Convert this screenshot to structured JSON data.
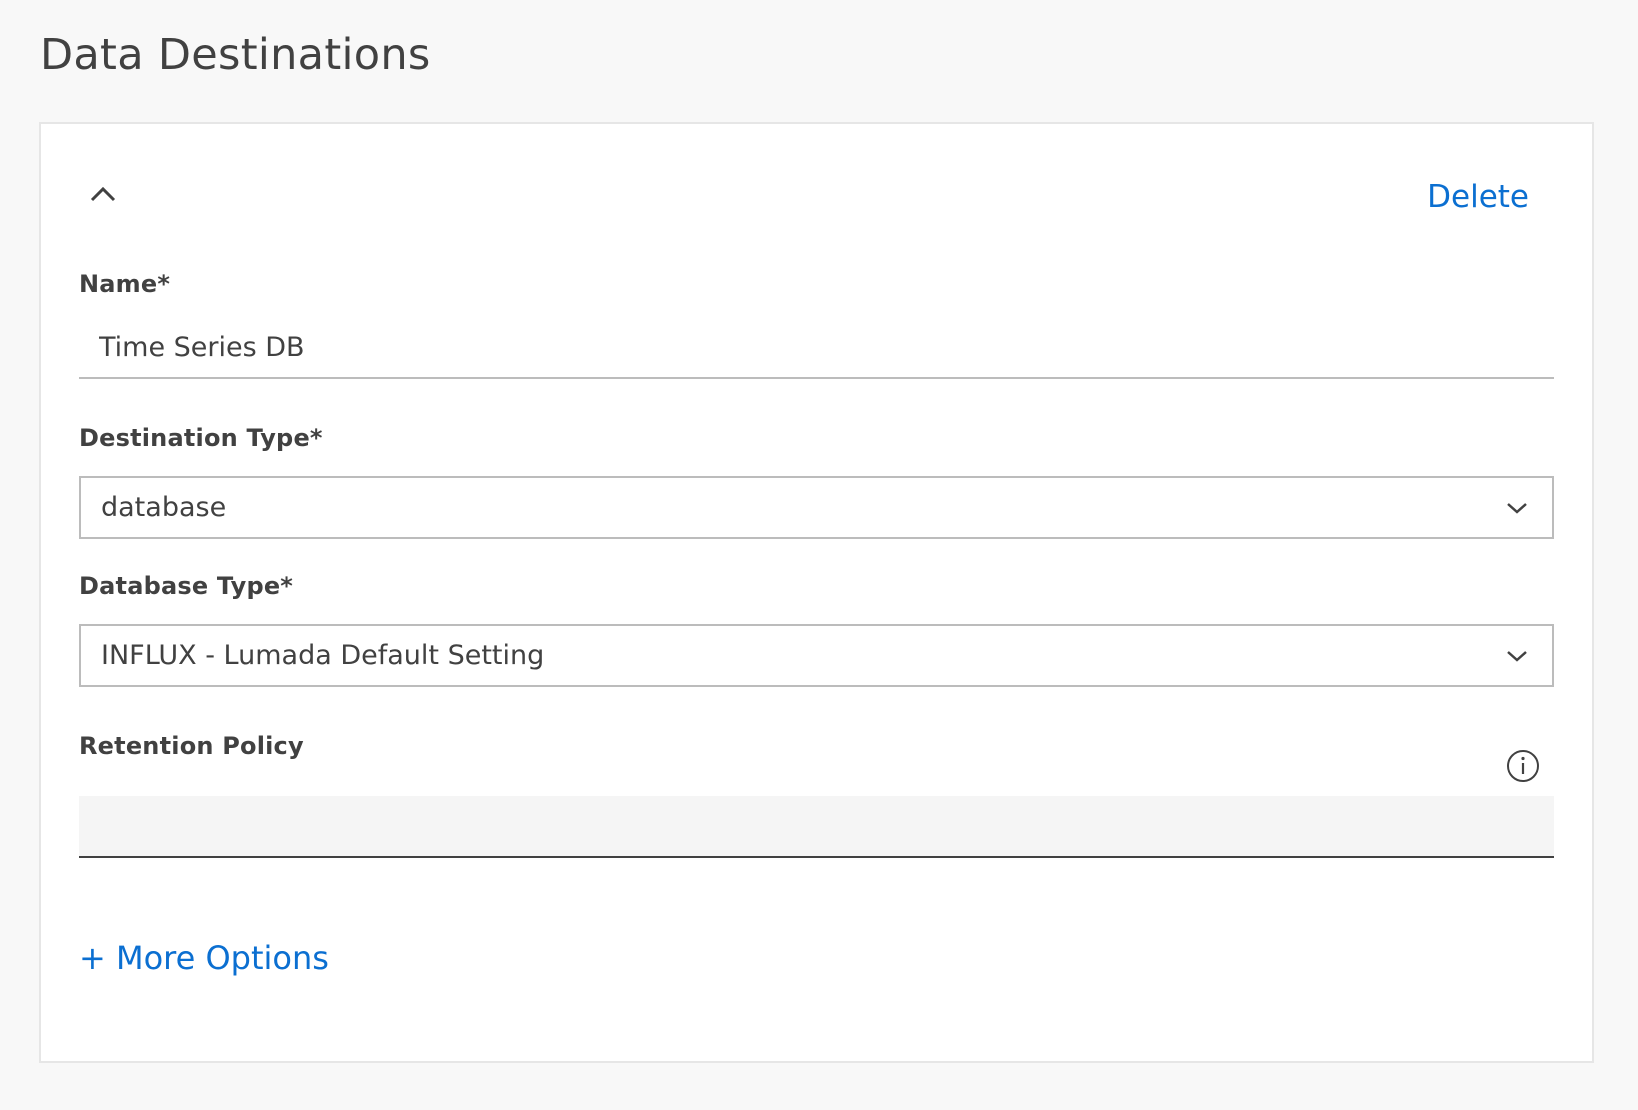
{
  "page": {
    "title": "Data Destinations"
  },
  "card": {
    "delete_label": "Delete",
    "collapse_icon": "chevron-up-icon",
    "name_field": {
      "label": "Name*",
      "value": "Time Series DB"
    },
    "destination_type": {
      "label": "Destination Type*",
      "selected": "database",
      "icon": "chevron-down-icon"
    },
    "database_type": {
      "label": "Database Type*",
      "selected": "INFLUX - Lumada Default Setting",
      "icon": "chevron-down-icon"
    },
    "retention_policy": {
      "label": "Retention Policy",
      "value": "",
      "info_icon": "info-icon"
    },
    "more_options_label": "+ More Options"
  },
  "colors": {
    "accent": "#0b6fd1",
    "text": "#414141",
    "background": "#f8f8f8",
    "card_border": "#e6e6e6",
    "input_border": "#bcbcbc"
  }
}
